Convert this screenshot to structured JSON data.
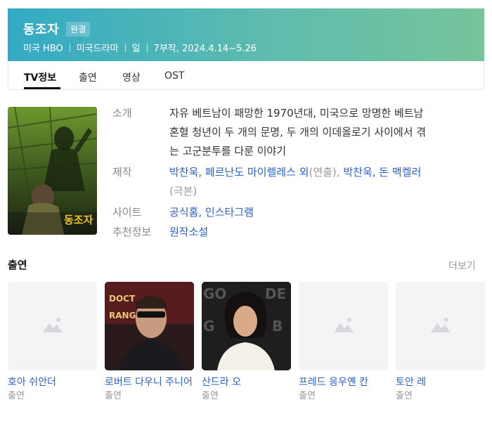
{
  "header": {
    "title": "동조자",
    "badge": "완결",
    "meta": [
      "미국 HBO",
      "미국드라마",
      "일",
      "7부작, 2024.4.14~5.26"
    ]
  },
  "tabs": [
    "TV정보",
    "출연",
    "영상",
    "OST"
  ],
  "poster": {
    "title_text": "동조자"
  },
  "info": {
    "intro_label": "소개",
    "intro_lines": [
      "자유 베트남이 패망한 1970년대, 미국으로 망명한 베트남",
      "혼혈 청년이 두 개의 문명, 두 개의 이데올로기 사이에서 겪",
      "는 고군분투를 다룬 이야기"
    ],
    "production_label": "제작",
    "production_links_1": "박찬욱, 페르난도 마이렐레스 외",
    "production_role_1": "(연출),",
    "production_links_2": "박찬욱, 돈 맥켈러",
    "production_role_2": "(극본)",
    "site_label": "사이트",
    "site_links": "공식홈, 인스타그램",
    "recommend_label": "추천정보",
    "recommend_link": "원작소설"
  },
  "cast_section": {
    "title": "출연",
    "more": "더보기",
    "members": [
      {
        "name": "호아 쉬안더",
        "role": "출연"
      },
      {
        "name": "로버트 다우니 주니어",
        "role": "출연"
      },
      {
        "name": "산드라 오",
        "role": "출연"
      },
      {
        "name": "프레드 응우옌 칸",
        "role": "출연"
      },
      {
        "name": "토안 레",
        "role": "출연"
      }
    ]
  }
}
